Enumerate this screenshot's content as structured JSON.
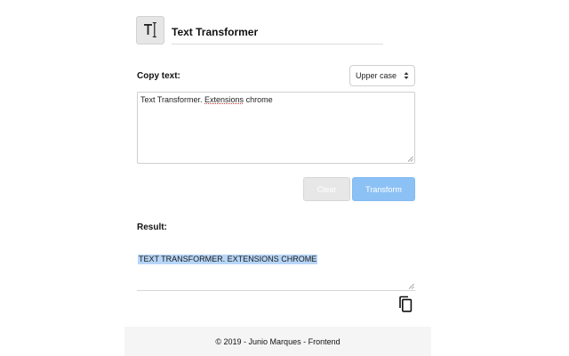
{
  "header": {
    "logo_icon": "text-cursor-icon",
    "title": "Text Transformer"
  },
  "input": {
    "label": "Copy text:",
    "case_select": {
      "selected": "Upper case"
    },
    "text_before": "Text Transformer. ",
    "text_underlined": "Extensions",
    "text_after": " chrome"
  },
  "buttons": {
    "clear_label": "Clear",
    "transform_label": "Transform"
  },
  "result": {
    "label": "Result:",
    "text": "TEXT TRANSFORMER. EXTENSIONS CHROME",
    "copy_icon": "copy-icon"
  },
  "footer": {
    "text": "© 2019 - Junio Marques - Frontend"
  },
  "colors": {
    "transform_button": "#8cc1f5",
    "clear_button": "#e7e7e7",
    "selection": "#b7d6f7",
    "footer_bg": "#f5f5f5"
  }
}
